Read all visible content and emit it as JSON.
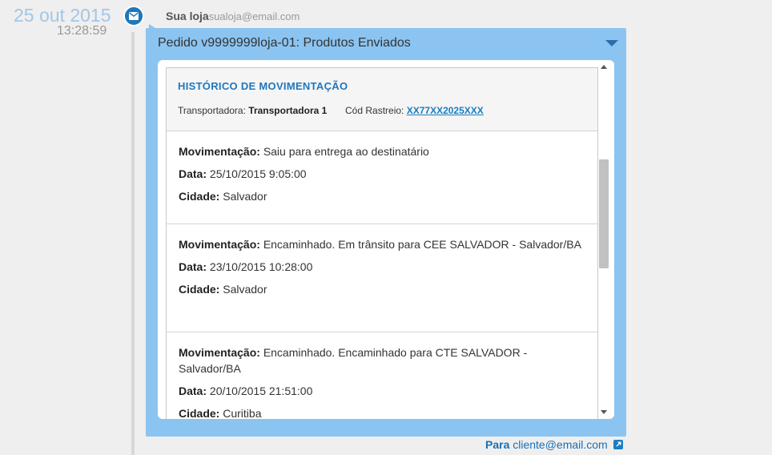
{
  "timeline": {
    "date": "25 out 2015",
    "time": "13:28:59",
    "badge_icon": "envelope-icon"
  },
  "sender": {
    "name": "Sua loja",
    "email": "sualoja@email.com"
  },
  "message": {
    "subject": "Pedido v9999999loja-01: Produtos Enviados",
    "collapse_icon": "caret-down-icon",
    "bg_color": "#8bc4f1"
  },
  "history": {
    "title": "HISTÓRICO DE MOVIMENTAÇÃO",
    "carrier_label": "Transportadora:",
    "carrier_value": "Transportadora 1",
    "tracking_label": "Cód Rastreio:",
    "tracking_value": "XX77XX2025XXX",
    "labels": {
      "movement": "Movimentação:",
      "date": "Data:",
      "city": "Cidade:"
    },
    "entries": [
      {
        "movement": "Saiu para entrega ao destinatário",
        "date": "25/10/2015 9:05:00",
        "city": "Salvador"
      },
      {
        "movement": "Encaminhado. Em trânsito para CEE SALVADOR - Salvador/BA",
        "date": "23/10/2015 10:28:00",
        "city": "Salvador"
      },
      {
        "movement": "Encaminhado. Encaminhado para CTE SALVADOR - Salvador/BA",
        "date": "20/10/2015 21:51:00",
        "city": "Curitiba"
      }
    ]
  },
  "recipient": {
    "label": "Para",
    "email": "cliente@email.com",
    "icon": "external-link-icon"
  },
  "colors": {
    "accent": "#1f77b8",
    "title": "#2077bd"
  }
}
